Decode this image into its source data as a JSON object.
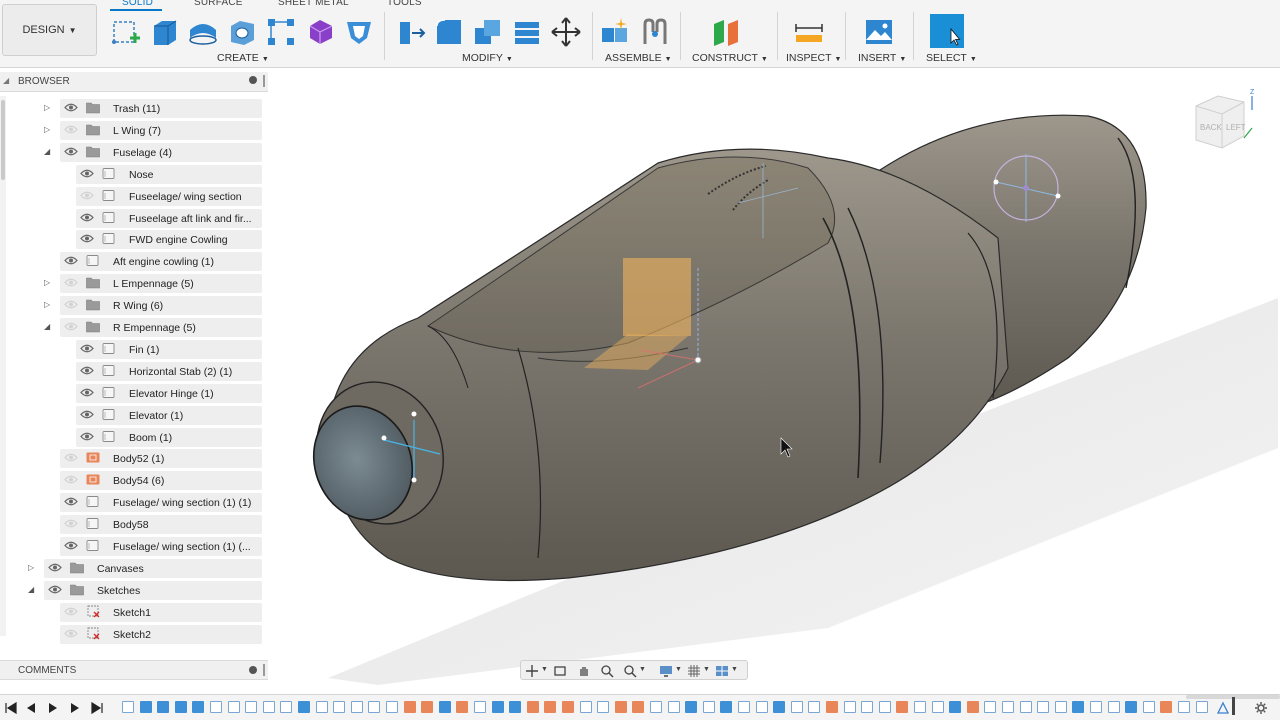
{
  "workspace": {
    "label": "DESIGN"
  },
  "tabs": [
    {
      "label": "SOLID",
      "active": true
    },
    {
      "label": "SURFACE",
      "active": false
    },
    {
      "label": "SHEET METAL",
      "active": false
    },
    {
      "label": "TOOLS",
      "active": false
    }
  ],
  "toolbar_groups": {
    "create": "CREATE",
    "modify": "MODIFY",
    "assemble": "ASSEMBLE",
    "construct": "CONSTRUCT",
    "inspect": "INSPECT",
    "insert": "INSERT",
    "select": "SELECT"
  },
  "colors": {
    "accent": "#0a78c8",
    "body_tint": "#6e6a63",
    "component_orange": "#e8865a",
    "sketch_red": "#d42a2a"
  },
  "browser": {
    "title": "BROWSER",
    "items": [
      {
        "label": "Trash (11)",
        "expander": "collapsed",
        "visible": true,
        "icon": "folder-icon"
      },
      {
        "label": "L Wing (7)",
        "expander": "collapsed",
        "visible": false,
        "icon": "folder-icon"
      },
      {
        "label": "Fuselage (4)",
        "expander": "expanded",
        "visible": true,
        "icon": "folder-icon"
      },
      {
        "label": "Nose",
        "expander": "none",
        "visible": true,
        "icon": "body-icon"
      },
      {
        "label": "Fuseelage/ wing section",
        "expander": "none",
        "visible": false,
        "icon": "body-icon"
      },
      {
        "label": "Fuseelage aft link and fir...",
        "expander": "none",
        "visible": true,
        "icon": "body-icon"
      },
      {
        "label": "FWD engine Cowling",
        "expander": "none",
        "visible": true,
        "icon": "body-icon"
      },
      {
        "label": "Aft engine cowling (1)",
        "expander": "none",
        "visible": true,
        "icon": "body-icon"
      },
      {
        "label": "L Empennage (5)",
        "expander": "collapsed",
        "visible": false,
        "icon": "folder-icon"
      },
      {
        "label": "R Wing (6)",
        "expander": "collapsed",
        "visible": false,
        "icon": "folder-icon"
      },
      {
        "label": "R Empennage (5)",
        "expander": "expanded",
        "visible": false,
        "icon": "folder-icon"
      },
      {
        "label": "Fin (1)",
        "expander": "none",
        "visible": true,
        "icon": "body-icon"
      },
      {
        "label": "Horizontal Stab (2) (1)",
        "expander": "none",
        "visible": true,
        "icon": "body-icon"
      },
      {
        "label": "Elevator Hinge (1)",
        "expander": "none",
        "visible": true,
        "icon": "body-icon"
      },
      {
        "label": "Elevator (1)",
        "expander": "none",
        "visible": true,
        "icon": "body-icon"
      },
      {
        "label": "Boom (1)",
        "expander": "none",
        "visible": true,
        "icon": "body-icon"
      },
      {
        "label": "Body52 (1)",
        "expander": "none",
        "visible": false,
        "icon": "component-icon"
      },
      {
        "label": "Body54 (6)",
        "expander": "none",
        "visible": false,
        "icon": "component-icon"
      },
      {
        "label": "Fuselage/ wing section (1) (1)",
        "expander": "none",
        "visible": true,
        "icon": "body-icon"
      },
      {
        "label": "Body58",
        "expander": "none",
        "visible": false,
        "icon": "body-icon"
      },
      {
        "label": "Fuselage/ wing section (1) (...",
        "expander": "none",
        "visible": true,
        "icon": "body-icon"
      },
      {
        "label": "Canvases",
        "expander": "collapsed",
        "visible": true,
        "icon": "folder-icon"
      },
      {
        "label": "Sketches",
        "expander": "expanded",
        "visible": true,
        "icon": "folder-icon"
      },
      {
        "label": "Sketch1",
        "expander": "none",
        "visible": false,
        "icon": "sketch-icon"
      },
      {
        "label": "Sketch2",
        "expander": "none",
        "visible": false,
        "icon": "sketch-icon"
      }
    ]
  },
  "comments": {
    "title": "COMMENTS"
  },
  "viewcube": {
    "back": "BACK",
    "left": "LEFT"
  },
  "timeline": {
    "features": [
      "sketch",
      "body",
      "body",
      "body",
      "body",
      "sketch",
      "sketch",
      "sketch",
      "sketch",
      "sketch",
      "body",
      "sketch",
      "sketch",
      "sketch",
      "sketch",
      "sketch",
      "comp",
      "comp",
      "body",
      "comp",
      "sketch",
      "body",
      "body",
      "comp",
      "comp",
      "comp",
      "sketch",
      "sketch",
      "comp",
      "comp",
      "sketch",
      "sketch",
      "body",
      "sketch",
      "body",
      "sketch",
      "sketch",
      "body",
      "sketch",
      "sketch",
      "comp",
      "sketch",
      "sketch",
      "sketch",
      "comp",
      "sketch",
      "sketch",
      "body",
      "comp",
      "sketch",
      "sketch",
      "sketch",
      "sketch",
      "sketch",
      "body",
      "sketch",
      "sketch",
      "body",
      "sketch",
      "comp",
      "sketch",
      "sketch"
    ]
  }
}
